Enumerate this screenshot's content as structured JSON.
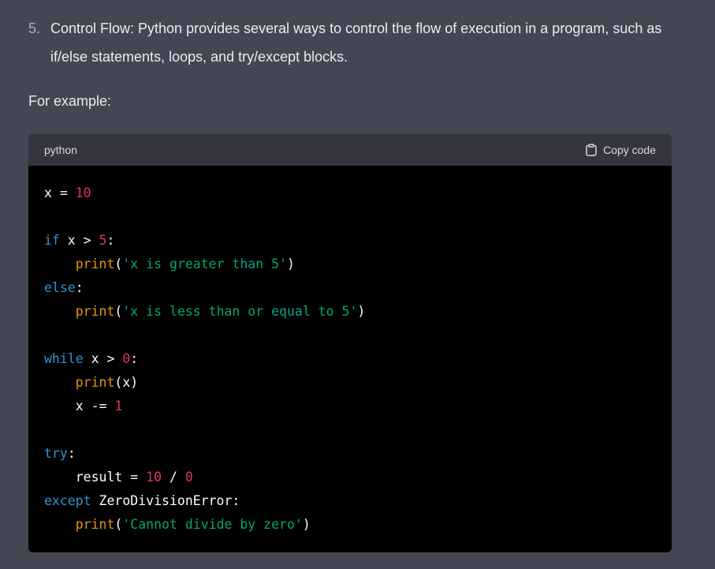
{
  "list": {
    "number": "5.",
    "text": "Control Flow: Python provides several ways to control the flow of execution in a program, such as if/else statements, loops, and try/except blocks."
  },
  "example_label": "For example:",
  "code_block": {
    "language": "python",
    "copy_label": "Copy code",
    "icon": "clipboard-icon",
    "lines": [
      [
        {
          "t": "x = ",
          "c": "plain"
        },
        {
          "t": "10",
          "c": "num"
        }
      ],
      [],
      [
        {
          "t": "if",
          "c": "kw"
        },
        {
          "t": " x > ",
          "c": "plain"
        },
        {
          "t": "5",
          "c": "num"
        },
        {
          "t": ":",
          "c": "plain"
        }
      ],
      [
        {
          "t": "    ",
          "c": "plain"
        },
        {
          "t": "print",
          "c": "builtin"
        },
        {
          "t": "(",
          "c": "plain"
        },
        {
          "t": "'x is greater than 5'",
          "c": "str"
        },
        {
          "t": ")",
          "c": "plain"
        }
      ],
      [
        {
          "t": "else",
          "c": "kw"
        },
        {
          "t": ":",
          "c": "plain"
        }
      ],
      [
        {
          "t": "    ",
          "c": "plain"
        },
        {
          "t": "print",
          "c": "builtin"
        },
        {
          "t": "(",
          "c": "plain"
        },
        {
          "t": "'x is less than or equal to 5'",
          "c": "str"
        },
        {
          "t": ")",
          "c": "plain"
        }
      ],
      [],
      [
        {
          "t": "while",
          "c": "kw"
        },
        {
          "t": " x > ",
          "c": "plain"
        },
        {
          "t": "0",
          "c": "num"
        },
        {
          "t": ":",
          "c": "plain"
        }
      ],
      [
        {
          "t": "    ",
          "c": "plain"
        },
        {
          "t": "print",
          "c": "builtin"
        },
        {
          "t": "(x)",
          "c": "plain"
        }
      ],
      [
        {
          "t": "    x -= ",
          "c": "plain"
        },
        {
          "t": "1",
          "c": "num"
        }
      ],
      [],
      [
        {
          "t": "try",
          "c": "kw"
        },
        {
          "t": ":",
          "c": "plain"
        }
      ],
      [
        {
          "t": "    result = ",
          "c": "plain"
        },
        {
          "t": "10",
          "c": "num"
        },
        {
          "t": " / ",
          "c": "plain"
        },
        {
          "t": "0",
          "c": "num"
        }
      ],
      [
        {
          "t": "except",
          "c": "kw"
        },
        {
          "t": " ZeroDivisionError:",
          "c": "plain"
        }
      ],
      [
        {
          "t": "    ",
          "c": "plain"
        },
        {
          "t": "print",
          "c": "builtin"
        },
        {
          "t": "(",
          "c": "plain"
        },
        {
          "t": "'Cannot divide by zero'",
          "c": "str"
        },
        {
          "t": ")",
          "c": "plain"
        }
      ]
    ]
  },
  "colors": {
    "page_background": "#444654",
    "code_background": "#000000",
    "code_header_background": "#343541",
    "keyword": "#2e95d3",
    "number": "#df3079",
    "builtin": "#e9950c",
    "string": "#00a67d"
  }
}
